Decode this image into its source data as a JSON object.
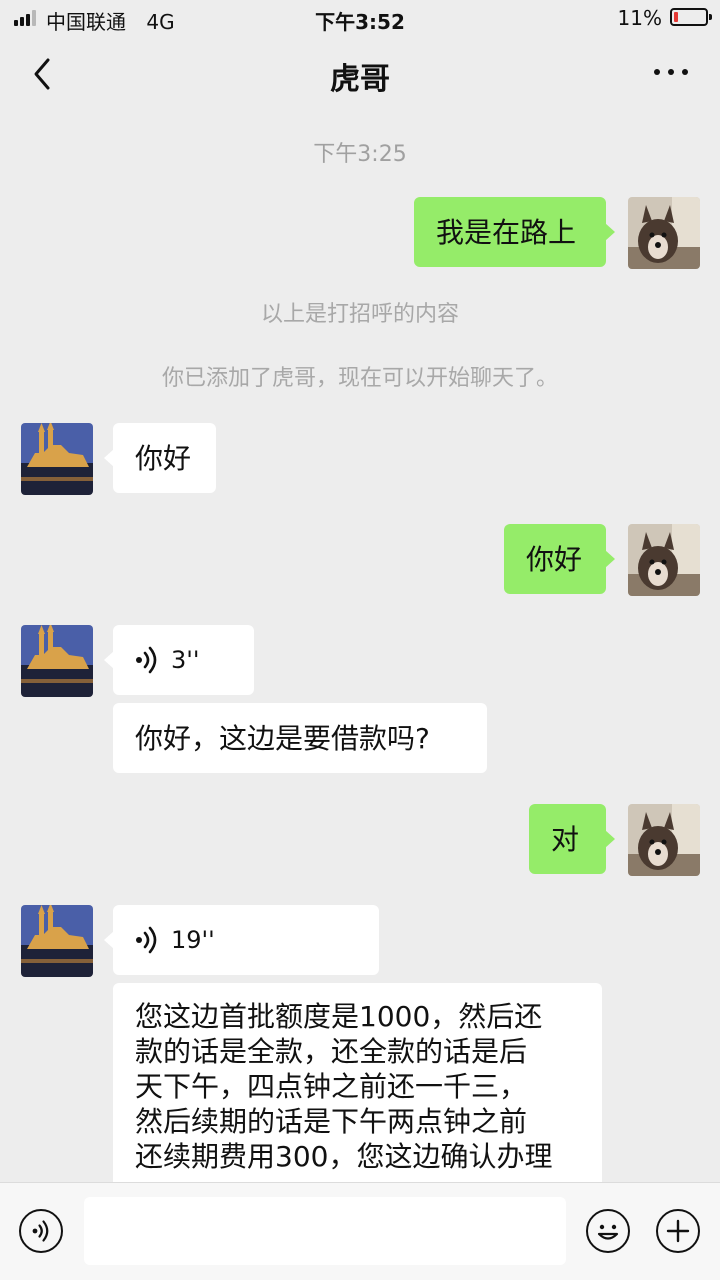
{
  "status_bar": {
    "carrier": "中国联通",
    "network": "4G",
    "time": "下午3:52",
    "battery": "11%",
    "battery_level": 0.11
  },
  "header": {
    "title": "虎哥",
    "back_icon": "chevron-left-icon",
    "more_icon": "more-dots-icon"
  },
  "chat": {
    "timestamp": "下午3:25",
    "greeting_message": "我是在路上",
    "system_1": "以上是打招呼的内容",
    "system_2": "你已添加了虎哥，现在可以开始聊天了。",
    "msg_hello_in": "你好",
    "msg_hello_out": "你好",
    "voice_1_duration": "3''",
    "msg_loan_question": "你好，这边是要借款吗?",
    "msg_confirm": "对",
    "voice_2_duration": "19''",
    "msg_long": [
      "您这边首批额度是1000，然后还",
      "款的话是全款，还全款的话是后",
      "天下午，四点钟之前还一千三，",
      "然后续期的话是下午两点钟之前",
      "还续期费用300，您这边确认办理"
    ]
  },
  "input_bar": {
    "voice_icon": "voice-toggle-icon",
    "emoji_icon": "emoji-icon",
    "plus_icon": "plus-icon",
    "text_value": ""
  },
  "colors": {
    "background": "#ededed",
    "outgoing_bubble": "#95ec69",
    "incoming_bubble": "#ffffff",
    "battery_low": "#e53935"
  }
}
